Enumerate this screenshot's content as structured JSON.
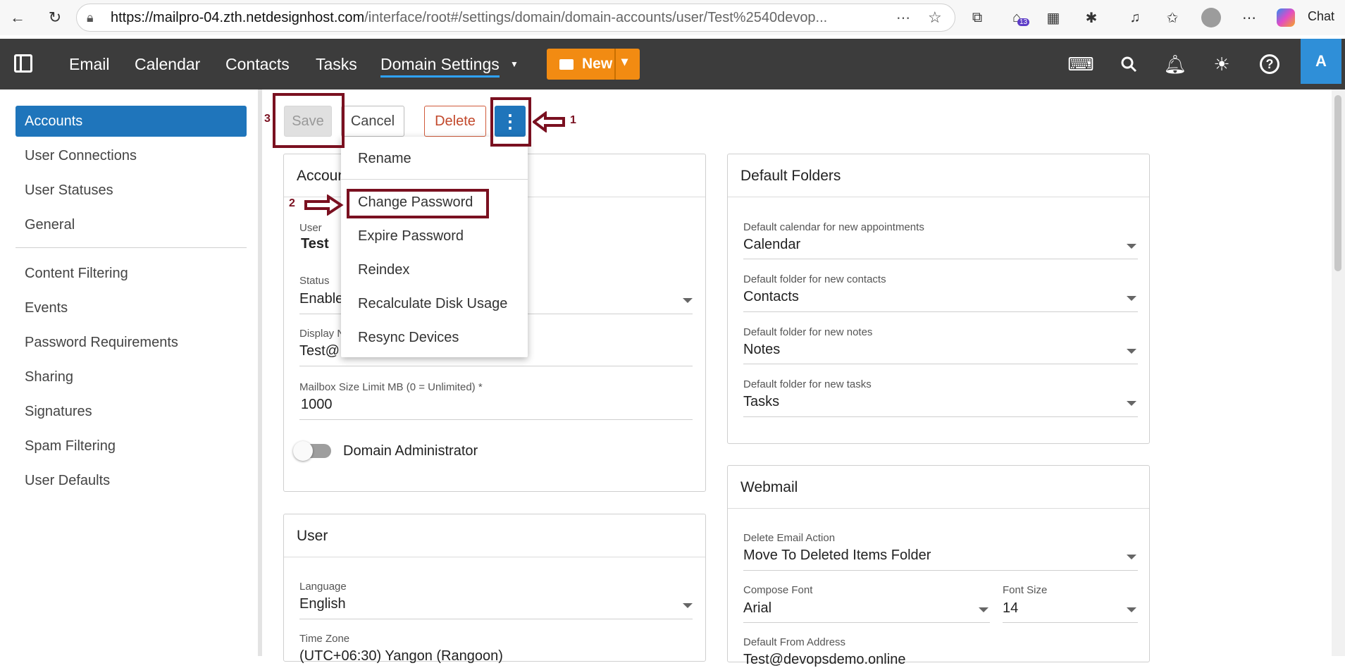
{
  "browser": {
    "url_host": "https://mailpro-04.zth.netdesignhost.com",
    "url_path": "/interface/root#/settings/domain/domain-accounts/user/Test%2540devop...",
    "badge_count": "13",
    "chat_label": "Chat"
  },
  "header": {
    "nav": [
      "Email",
      "Calendar",
      "Contacts",
      "Tasks",
      "Domain Settings"
    ],
    "new_label": "New",
    "avatar_letter": "A"
  },
  "sidebar": {
    "items": [
      "Accounts",
      "User Connections",
      "User Statuses",
      "General",
      "Content Filtering",
      "Events",
      "Password Requirements",
      "Sharing",
      "Signatures",
      "Spam Filtering",
      "User Defaults"
    ]
  },
  "toolbar": {
    "save_label": "Save",
    "cancel_label": "Cancel",
    "delete_label": "Delete",
    "more_label": "⋮"
  },
  "callouts": {
    "one": "1",
    "two": "2",
    "three": "3"
  },
  "menu": {
    "items": [
      "Rename",
      "Change Password",
      "Expire Password",
      "Reindex",
      "Recalculate Disk Usage",
      "Resync Devices"
    ]
  },
  "account_card": {
    "title": "Accoun",
    "user_label": "User",
    "user_value": "Test",
    "status_label": "Status",
    "status_value": "Enable",
    "display_label": "Display N",
    "display_value": "Test@",
    "mailbox_label": "Mailbox Size Limit MB (0 = Unlimited) *",
    "mailbox_value": "1000",
    "domain_admin_label": "Domain Administrator"
  },
  "user_card": {
    "title": "User",
    "language_label": "Language",
    "language_value": "English",
    "timezone_label": "Time Zone",
    "timezone_value": "(UTC+06:30) Yangon (Rangoon)"
  },
  "folders_card": {
    "title": "Default Folders",
    "fields": [
      {
        "label": "Default calendar for new appointments",
        "value": "Calendar"
      },
      {
        "label": "Default folder for new contacts",
        "value": "Contacts"
      },
      {
        "label": "Default folder for new notes",
        "value": "Notes"
      },
      {
        "label": "Default folder for new tasks",
        "value": "Tasks"
      }
    ]
  },
  "webmail_card": {
    "title": "Webmail",
    "delete_label": "Delete Email Action",
    "delete_value": "Move To Deleted Items Folder",
    "font_label": "Compose Font",
    "font_value": "Arial",
    "size_label": "Font Size",
    "size_value": "14",
    "from_label": "Default From Address",
    "from_value": "Test@devopsdemo.online"
  }
}
